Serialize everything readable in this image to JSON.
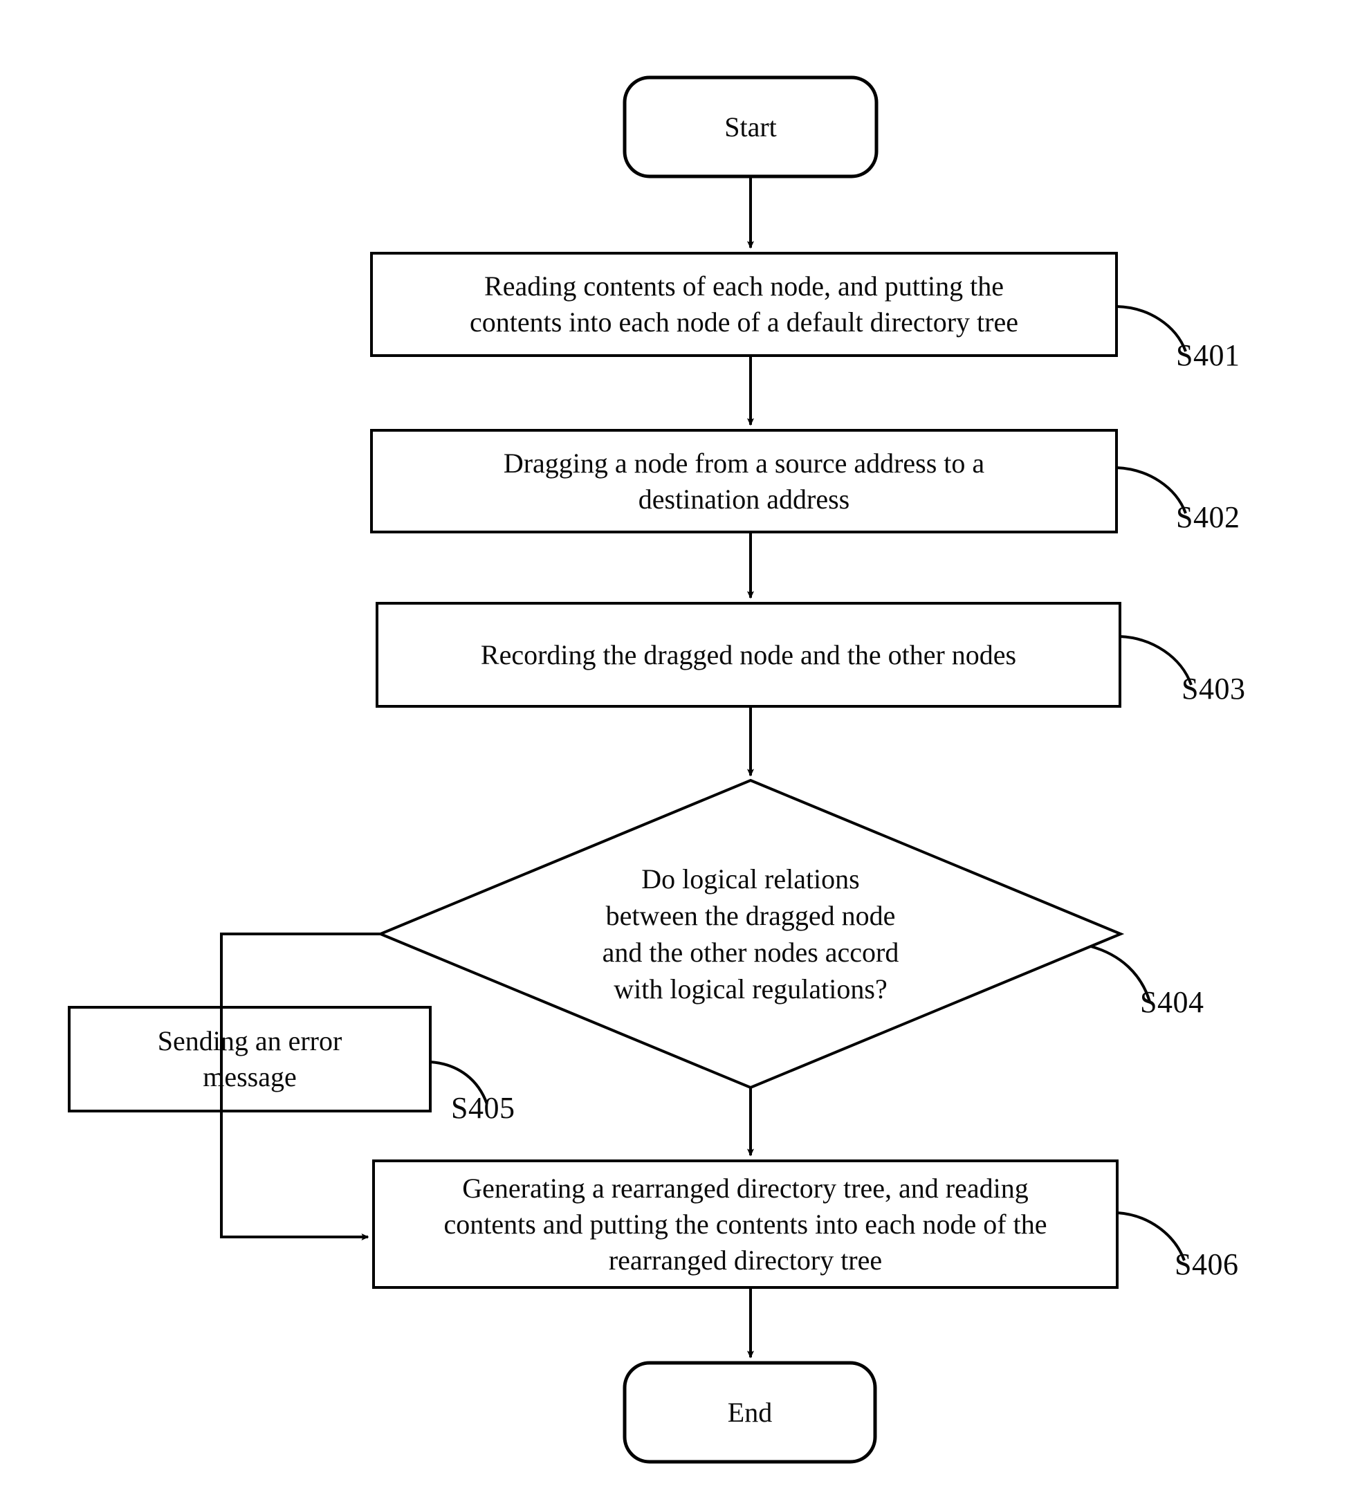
{
  "diagram": {
    "type": "flowchart",
    "title": "Directory tree rearrangement process",
    "orientation": "vertical",
    "colors": {
      "stroke": "#000000",
      "background": "#ffffff",
      "text": "#0a0a0a"
    }
  },
  "nodes": {
    "start": {
      "shape": "rounded-rectangle",
      "label": "Start"
    },
    "s401": {
      "shape": "rectangle",
      "label": "Reading contents of each node, and putting the\ncontents into each node of a default directory tree",
      "tag": "S401"
    },
    "s402": {
      "shape": "rectangle",
      "label": "Dragging a node from a source address to a\ndestination address",
      "tag": "S402"
    },
    "s403": {
      "shape": "rectangle",
      "label": "Recording the dragged node and the other nodes",
      "tag": "S403"
    },
    "s404": {
      "shape": "diamond",
      "label": "Do logical relations\nbetween the dragged node\nand the other nodes accord\nwith logical regulations?",
      "tag": "S404"
    },
    "s405": {
      "shape": "rectangle",
      "label": "Sending an error\nmessage",
      "tag": "S405"
    },
    "s406": {
      "shape": "rectangle",
      "label": "Generating a rearranged directory tree, and reading\ncontents and putting the contents into each node of the\nrearranged directory tree",
      "tag": "S406"
    },
    "end": {
      "shape": "rounded-rectangle",
      "label": "End"
    }
  },
  "edges": [
    {
      "from": "start",
      "to": "s401",
      "label": ""
    },
    {
      "from": "s401",
      "to": "s402",
      "label": ""
    },
    {
      "from": "s402",
      "to": "s403",
      "label": ""
    },
    {
      "from": "s403",
      "to": "s404",
      "label": ""
    },
    {
      "from": "s404",
      "to": "s405",
      "label": ""
    },
    {
      "from": "s404",
      "to": "s406",
      "label": ""
    },
    {
      "from": "s405",
      "to": "s406",
      "label": ""
    },
    {
      "from": "s406",
      "to": "end",
      "label": ""
    }
  ]
}
